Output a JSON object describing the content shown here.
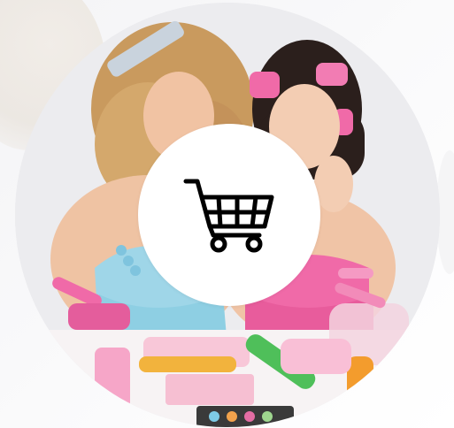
{
  "photo": {
    "subject_icon": "beauty-products-photo"
  },
  "cart_action": {
    "icon": "shopping-cart-icon",
    "icon_color": "#000000",
    "background": "#ffffff"
  },
  "colors": {
    "page_background": "#f6f6f8",
    "accent_pink": "#f06aa8",
    "accent_blue": "#9fd6e8"
  }
}
